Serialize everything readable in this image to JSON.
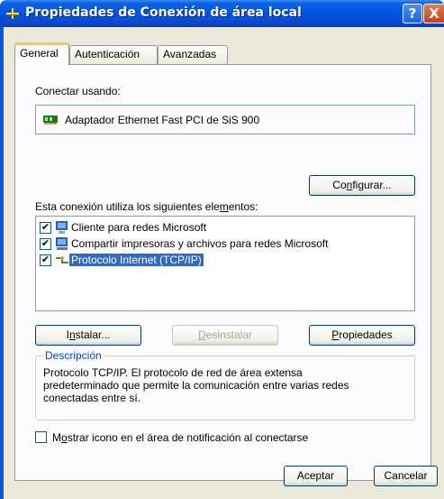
{
  "window": {
    "title": "Propiedades de Conexión de área local",
    "help_label": "?",
    "close_label": "X"
  },
  "tabs": [
    {
      "label": "General",
      "active": true
    },
    {
      "label": "Autenticación",
      "active": false
    },
    {
      "label": "Avanzadas",
      "active": false
    }
  ],
  "connect_using": {
    "label": "Conectar usando:",
    "adapter": "Adaptador Ethernet Fast PCI de SiS 900"
  },
  "configure_button": {
    "pre": "Co",
    "accel": "n",
    "post": "figurar..."
  },
  "components": {
    "label_pre": "Esta conexión utiliza los siguientes ele",
    "label_accel": "m",
    "label_post": "entos:",
    "items": [
      {
        "label": "Cliente para redes Microsoft",
        "checked": true,
        "selected": false,
        "icon": "network-client-icon"
      },
      {
        "label": "Compartir impresoras y archivos para redes Microsoft",
        "checked": true,
        "selected": false,
        "icon": "file-printer-sharing-icon"
      },
      {
        "label": "Protocolo Internet (TCP/IP)",
        "checked": true,
        "selected": true,
        "icon": "network-protocol-icon"
      }
    ],
    "check_mark": "✔"
  },
  "actions": {
    "install": {
      "pre": "I",
      "accel": "n",
      "post": "stalar..."
    },
    "uninstall": {
      "pre": "",
      "accel": "D",
      "post": "esinstalar"
    },
    "properties": {
      "pre": "",
      "accel": "P",
      "post": "ropiedades"
    }
  },
  "description": {
    "legend": "Descripción",
    "text_lines": [
      "Protocolo TCP/IP. El protocolo de red de área extensa",
      "predeterminado que permite la comunicación entre varias redes",
      "conectadas entre sí."
    ]
  },
  "show_icon": {
    "pre": "M",
    "accel": "o",
    "post": "strar icono en el área de notificación al conectarse",
    "checked": false
  },
  "footer": {
    "accept": "Aceptar",
    "cancel": "Cancelar"
  },
  "colors": {
    "titlebar": "#0053e1",
    "dialog_bg": "#ece9d8",
    "selection": "#316ac5",
    "group_legend": "#0046d5"
  }
}
